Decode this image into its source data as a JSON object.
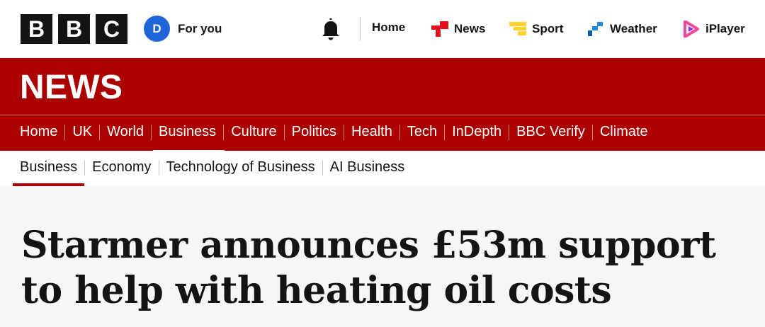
{
  "brand": {
    "letters": [
      "B",
      "B",
      "C"
    ]
  },
  "account": {
    "avatar_letter": "D",
    "label": "For you"
  },
  "global_nav": {
    "home": "Home",
    "news": "News",
    "sport": "Sport",
    "weather": "Weather",
    "iplayer": "iPlayer"
  },
  "colors": {
    "news_red": "#aa0000",
    "avatar_blue": "#1f64d8",
    "sport_yellow": "#ffd230",
    "weather_blue": "#1e88e5",
    "iplayer_pink": "#f54997"
  },
  "icons": {
    "notifications": "bell-icon",
    "news": "news-icon",
    "sport": "sport-icon",
    "weather": "weather-icon",
    "iplayer": "iplayer-icon"
  },
  "masthead": "NEWS",
  "section_nav": {
    "items": [
      "Home",
      "UK",
      "World",
      "Business",
      "Culture",
      "Politics",
      "Health",
      "Tech",
      "InDepth",
      "BBC Verify",
      "Climate"
    ],
    "active": "Business"
  },
  "sub_nav": {
    "items": [
      "Business",
      "Economy",
      "Technology of Business",
      "AI Business"
    ],
    "active": "Business"
  },
  "article": {
    "headline": "Starmer announces £53m support to help with heating oil costs"
  }
}
